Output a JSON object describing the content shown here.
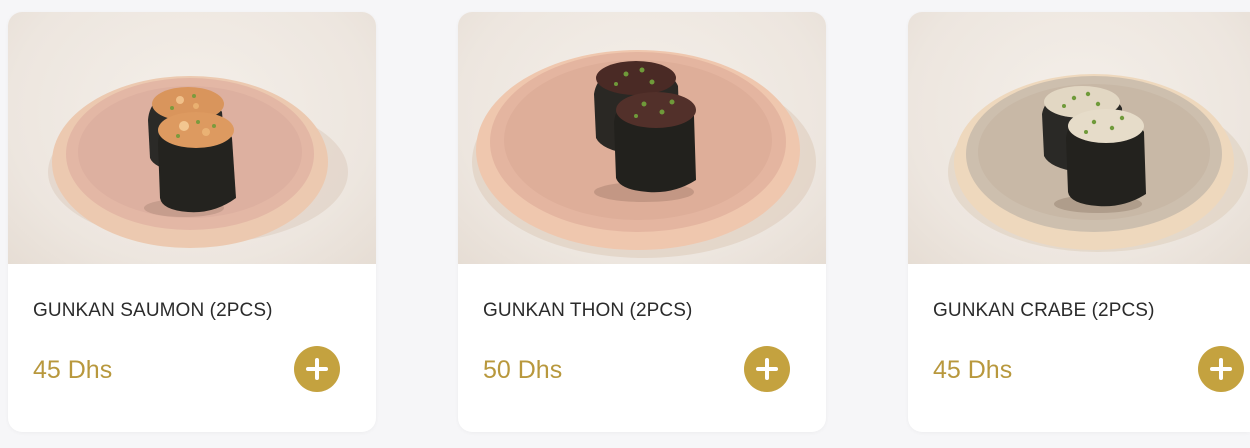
{
  "colors": {
    "accent": "#C4A23F",
    "price_text": "#B8983D",
    "title_text": "#2B2B2B",
    "card_bg": "#FFFFFF",
    "page_bg": "#F6F6F8"
  },
  "products": [
    {
      "title": "GUNKAN SAUMON (2PCS)",
      "price": "45 Dhs",
      "add_icon": "plus-icon"
    },
    {
      "title": "GUNKAN THON (2PCS)",
      "price": "50 Dhs",
      "add_icon": "plus-icon"
    },
    {
      "title": "GUNKAN CRABE (2PCS)",
      "price": "45 Dhs",
      "add_icon": "plus-icon"
    }
  ]
}
